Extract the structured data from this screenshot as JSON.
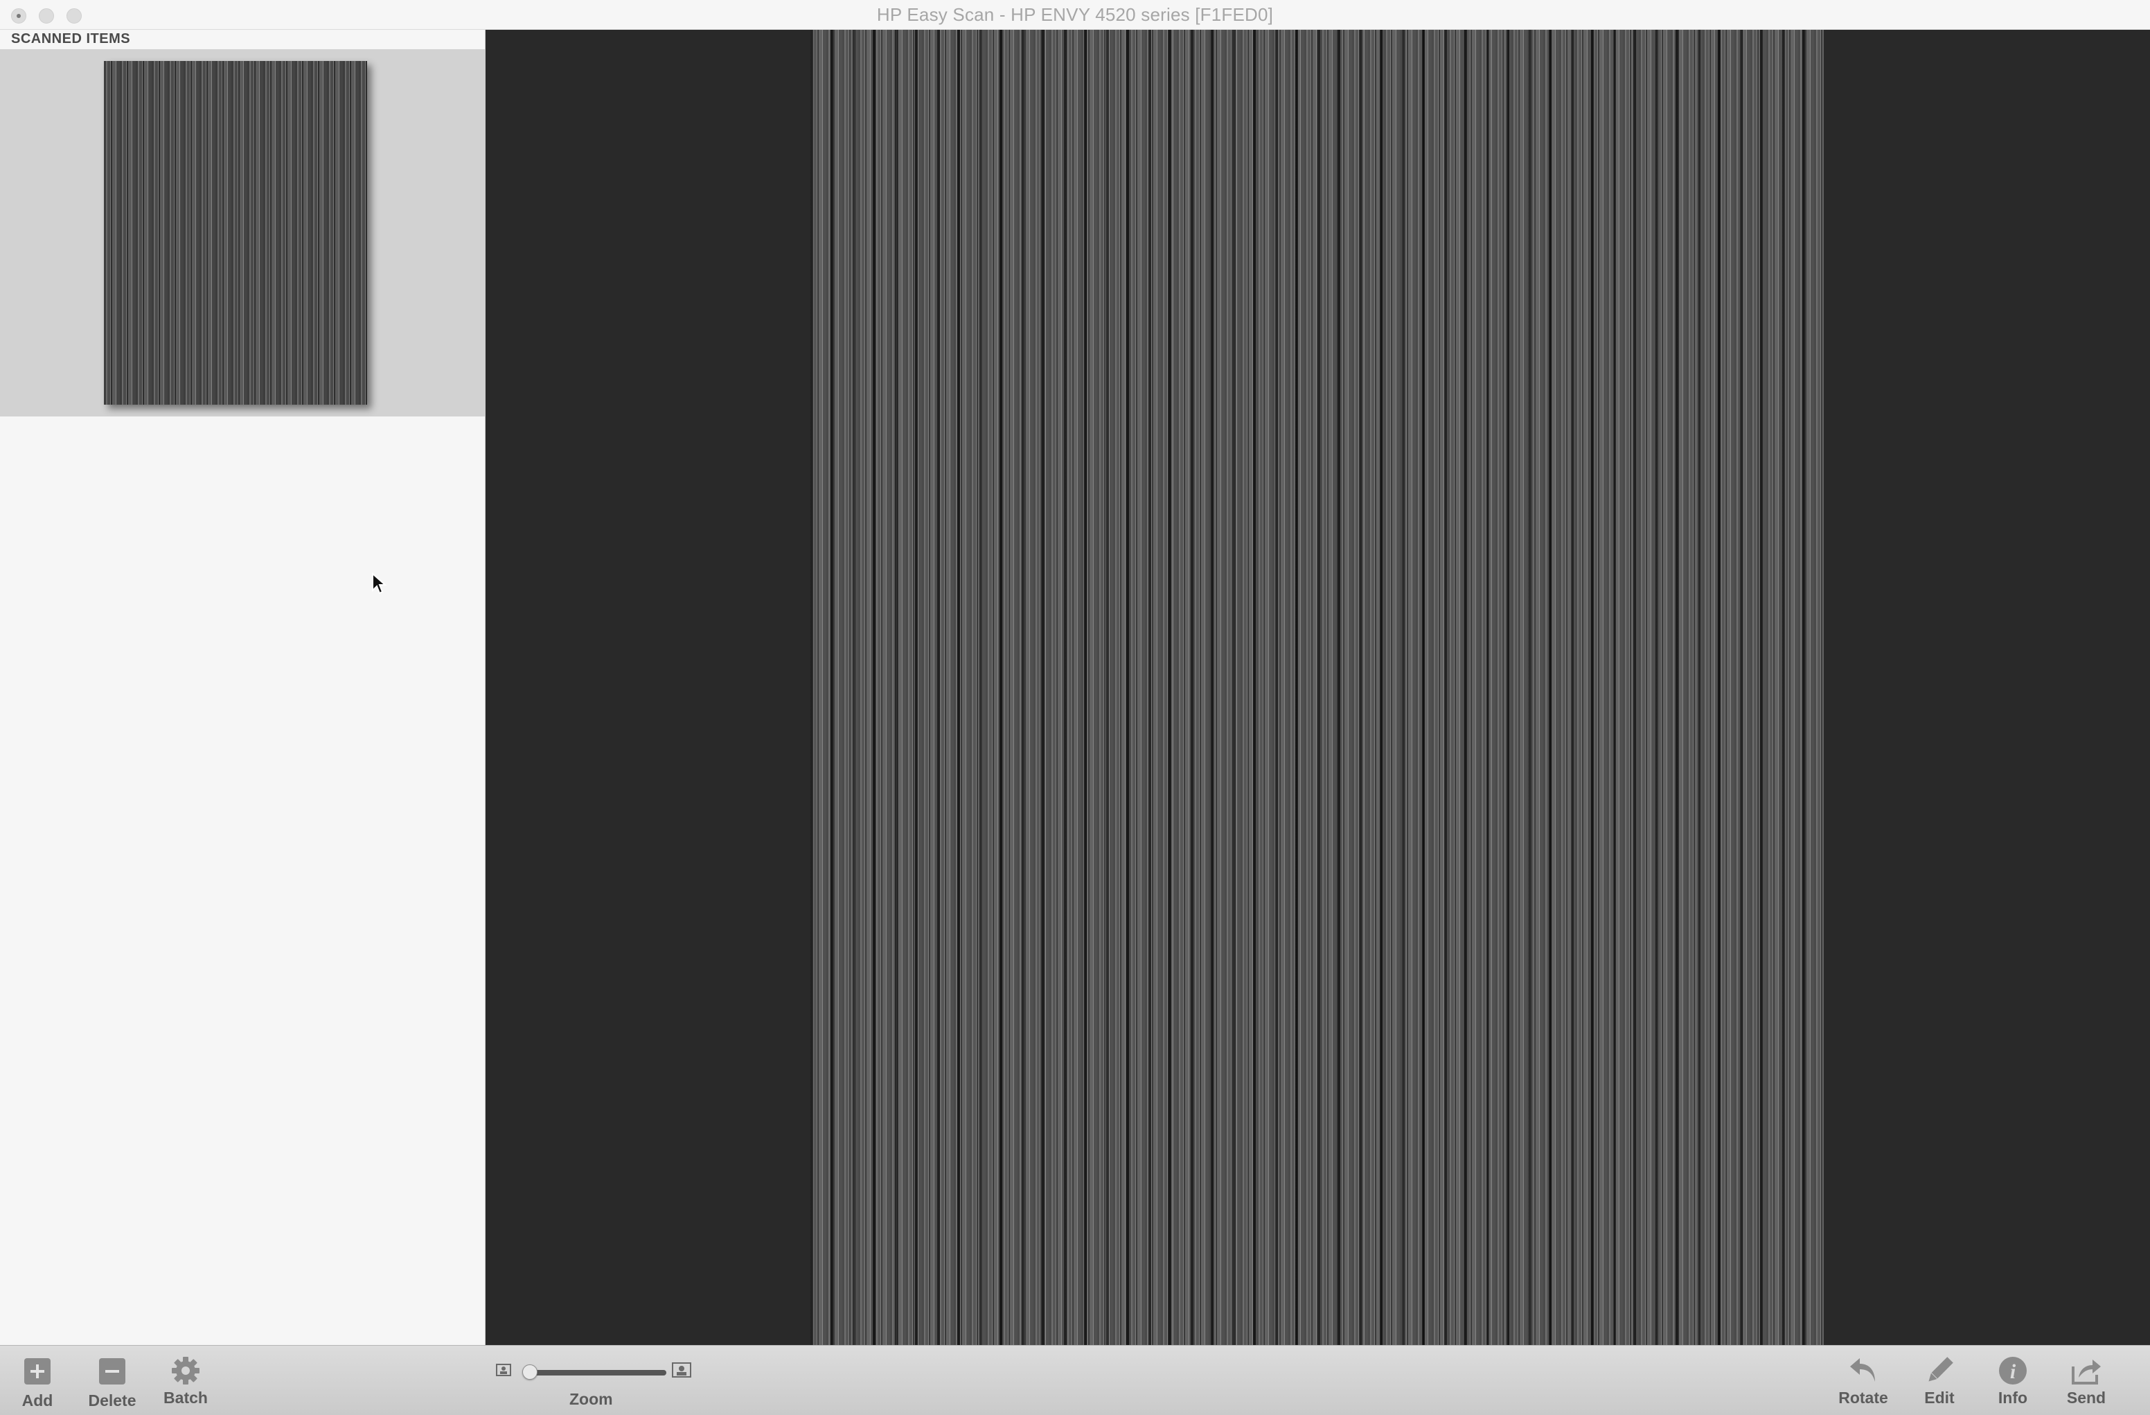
{
  "window": {
    "title": "HP Easy Scan - HP ENVY 4520 series [F1FED0]"
  },
  "sidebar": {
    "header": "SCANNED ITEMS",
    "items": [
      {
        "type": "scanned-page-thumbnail",
        "selected": true
      }
    ]
  },
  "toolbar": {
    "left_tools": [
      {
        "label": "Add",
        "icon": "plus-square-icon"
      },
      {
        "label": "Delete",
        "icon": "minus-square-icon"
      },
      {
        "label": "Batch",
        "icon": "gear-icon"
      }
    ],
    "zoom": {
      "label": "Zoom",
      "value": 0
    },
    "right_tools": [
      {
        "label": "Rotate",
        "icon": "rotate-left-icon"
      },
      {
        "label": "Edit",
        "icon": "pencil-icon"
      },
      {
        "label": "Info",
        "icon": "info-icon"
      },
      {
        "label": "Send",
        "icon": "share-icon"
      }
    ]
  },
  "colors": {
    "preview_background": "#292929",
    "sidebar_background": "#f6f6f6",
    "selection_background": "#d2d2d2",
    "toolbar_label": "#5c5c5c"
  }
}
